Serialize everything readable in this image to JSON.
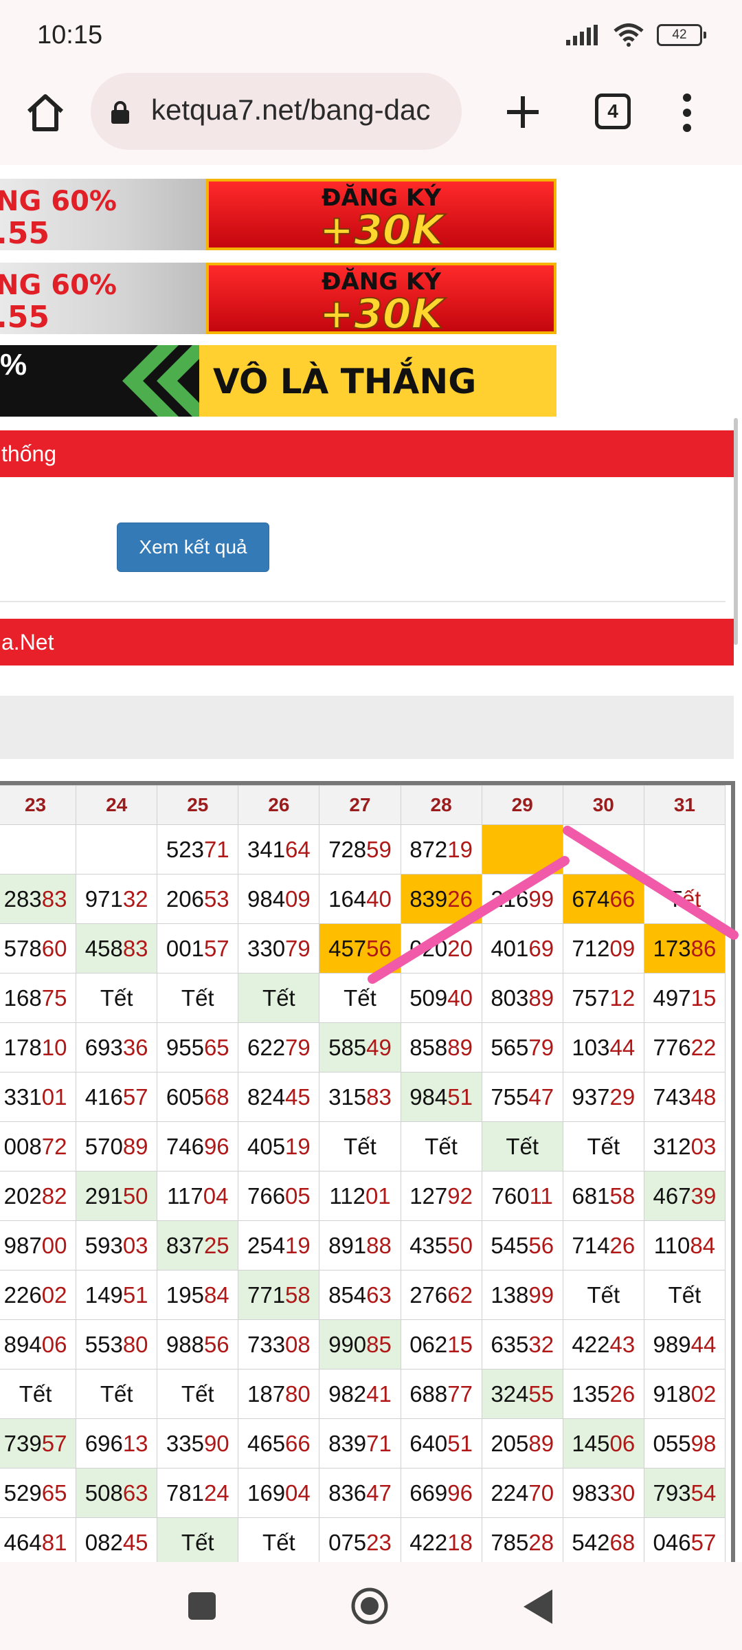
{
  "status": {
    "time": "10:15",
    "battery": "42"
  },
  "browser": {
    "url": "ketqua7.net/bang-dac",
    "tab_count": "4"
  },
  "banners": [
    {
      "left_line1": "NG 60%",
      "left_line2": ".55",
      "right_line1": "ĐĂNG KÝ",
      "right_line2": "+30K"
    },
    {
      "left_line1": "NG 60%",
      "left_line2": ".55",
      "right_line1": "ĐĂNG KÝ",
      "right_line2": "+30K"
    }
  ],
  "banner3": {
    "left": "%",
    "right": "VÔ LÀ THẮNG"
  },
  "section1_title": "thống",
  "view_button": "Xem kết quả",
  "section2_title": "a.Net",
  "table": {
    "headers": [
      "23",
      "24",
      "25",
      "26",
      "27",
      "28",
      "29",
      "30",
      "31"
    ],
    "rows": [
      [
        [
          "",
          ""
        ],
        [
          "",
          ""
        ],
        [
          "523",
          "71"
        ],
        [
          "341",
          "64"
        ],
        [
          "728",
          "59"
        ],
        [
          "872",
          "19"
        ],
        [
          "",
          ""
        ],
        [
          "",
          ""
        ],
        [
          "",
          ""
        ]
      ],
      [
        [
          "283",
          "83"
        ],
        [
          "971",
          "32"
        ],
        [
          "206",
          "53"
        ],
        [
          "984",
          "09"
        ],
        [
          "164",
          "40"
        ],
        [
          "839",
          "26"
        ],
        [
          "216",
          "99"
        ],
        [
          "674",
          "66"
        ],
        [
          "T",
          "ết"
        ]
      ],
      [
        [
          "578",
          "60"
        ],
        [
          "458",
          "83"
        ],
        [
          "001",
          "57"
        ],
        [
          "330",
          "79"
        ],
        [
          "457",
          "56"
        ],
        [
          "020",
          "20"
        ],
        [
          "401",
          "69"
        ],
        [
          "712",
          "09"
        ],
        [
          "173",
          "86"
        ]
      ],
      [
        [
          "168",
          "75"
        ],
        [
          "Tết",
          ""
        ],
        [
          "Tết",
          ""
        ],
        [
          "Tết",
          ""
        ],
        [
          "Tết",
          ""
        ],
        [
          "509",
          "40"
        ],
        [
          "803",
          "89"
        ],
        [
          "757",
          "12"
        ],
        [
          "497",
          "15"
        ]
      ],
      [
        [
          "178",
          "10"
        ],
        [
          "693",
          "36"
        ],
        [
          "955",
          "65"
        ],
        [
          "622",
          "79"
        ],
        [
          "585",
          "49"
        ],
        [
          "858",
          "89"
        ],
        [
          "565",
          "79"
        ],
        [
          "103",
          "44"
        ],
        [
          "776",
          "22"
        ]
      ],
      [
        [
          "331",
          "01"
        ],
        [
          "416",
          "57"
        ],
        [
          "605",
          "68"
        ],
        [
          "824",
          "45"
        ],
        [
          "315",
          "83"
        ],
        [
          "984",
          "51"
        ],
        [
          "755",
          "47"
        ],
        [
          "937",
          "29"
        ],
        [
          "743",
          "48"
        ]
      ],
      [
        [
          "008",
          "72"
        ],
        [
          "570",
          "89"
        ],
        [
          "746",
          "96"
        ],
        [
          "405",
          "19"
        ],
        [
          "Tết",
          ""
        ],
        [
          "Tết",
          ""
        ],
        [
          "Tết",
          ""
        ],
        [
          "Tết",
          ""
        ],
        [
          "312",
          "03"
        ]
      ],
      [
        [
          "202",
          "82"
        ],
        [
          "291",
          "50"
        ],
        [
          "117",
          "04"
        ],
        [
          "766",
          "05"
        ],
        [
          "112",
          "01"
        ],
        [
          "127",
          "92"
        ],
        [
          "760",
          "11"
        ],
        [
          "681",
          "58"
        ],
        [
          "467",
          "39"
        ]
      ],
      [
        [
          "987",
          "00"
        ],
        [
          "593",
          "03"
        ],
        [
          "837",
          "25"
        ],
        [
          "254",
          "19"
        ],
        [
          "891",
          "88"
        ],
        [
          "435",
          "50"
        ],
        [
          "545",
          "56"
        ],
        [
          "714",
          "26"
        ],
        [
          "110",
          "84"
        ]
      ],
      [
        [
          "226",
          "02"
        ],
        [
          "149",
          "51"
        ],
        [
          "195",
          "84"
        ],
        [
          "771",
          "58"
        ],
        [
          "854",
          "63"
        ],
        [
          "276",
          "62"
        ],
        [
          "138",
          "99"
        ],
        [
          "Tết",
          ""
        ],
        [
          "Tết",
          ""
        ]
      ],
      [
        [
          "894",
          "06"
        ],
        [
          "553",
          "80"
        ],
        [
          "988",
          "56"
        ],
        [
          "733",
          "08"
        ],
        [
          "990",
          "85"
        ],
        [
          "062",
          "15"
        ],
        [
          "635",
          "32"
        ],
        [
          "422",
          "43"
        ],
        [
          "989",
          "44"
        ]
      ],
      [
        [
          "Tết",
          ""
        ],
        [
          "Tết",
          ""
        ],
        [
          "Tết",
          ""
        ],
        [
          "187",
          "80"
        ],
        [
          "982",
          "41"
        ],
        [
          "688",
          "77"
        ],
        [
          "324",
          "55"
        ],
        [
          "135",
          "26"
        ],
        [
          "918",
          "02"
        ]
      ],
      [
        [
          "739",
          "57"
        ],
        [
          "696",
          "13"
        ],
        [
          "335",
          "90"
        ],
        [
          "465",
          "66"
        ],
        [
          "839",
          "71"
        ],
        [
          "640",
          "51"
        ],
        [
          "205",
          "89"
        ],
        [
          "145",
          "06"
        ],
        [
          "055",
          "98"
        ]
      ],
      [
        [
          "529",
          "65"
        ],
        [
          "508",
          "63"
        ],
        [
          "781",
          "24"
        ],
        [
          "169",
          "04"
        ],
        [
          "836",
          "47"
        ],
        [
          "669",
          "96"
        ],
        [
          "224",
          "70"
        ],
        [
          "983",
          "30"
        ],
        [
          "793",
          "54"
        ]
      ],
      [
        [
          "464",
          "81"
        ],
        [
          "082",
          "45"
        ],
        [
          "Tết",
          ""
        ],
        [
          "Tết",
          ""
        ],
        [
          "075",
          "23"
        ],
        [
          "422",
          "18"
        ],
        [
          "785",
          "28"
        ],
        [
          "542",
          "68"
        ],
        [
          "046",
          "57"
        ]
      ]
    ],
    "highlight": [
      [
        "",
        "",
        "",
        "",
        "",
        "",
        "y",
        "",
        ""
      ],
      [
        "g",
        "",
        "",
        "",
        "",
        "y",
        "",
        "y",
        ""
      ],
      [
        "",
        "g",
        "",
        "",
        "y",
        "",
        "",
        "",
        "y"
      ],
      [
        "",
        "",
        "",
        "g",
        "",
        "",
        "",
        "",
        ""
      ],
      [
        "",
        "",
        "",
        "",
        "g",
        "",
        "",
        "",
        ""
      ],
      [
        "",
        "",
        "",
        "",
        "",
        "g",
        "",
        "",
        ""
      ],
      [
        "",
        "",
        "",
        "",
        "",
        "",
        "g",
        "",
        ""
      ],
      [
        "",
        "g",
        "",
        "",
        "",
        "",
        "",
        "",
        "g"
      ],
      [
        "",
        "",
        "g",
        "",
        "",
        "",
        "",
        "",
        ""
      ],
      [
        "",
        "",
        "",
        "g",
        "",
        "",
        "",
        "",
        ""
      ],
      [
        "",
        "",
        "",
        "",
        "g",
        "",
        "",
        "",
        ""
      ],
      [
        "",
        "",
        "",
        "",
        "",
        "",
        "g",
        "",
        ""
      ],
      [
        "g",
        "",
        "",
        "",
        "",
        "",
        "",
        "g",
        ""
      ],
      [
        "",
        "g",
        "",
        "",
        "",
        "",
        "",
        "",
        "g"
      ],
      [
        "",
        "",
        "g",
        "",
        "",
        "",
        "",
        "",
        ""
      ]
    ]
  },
  "colors": {
    "accent_red": "#e8202a",
    "highlight_yellow": "#ffbd00",
    "highlight_green": "#e2f2de",
    "button_blue": "#337ab7",
    "annotation_pink": "#f05aa8"
  }
}
